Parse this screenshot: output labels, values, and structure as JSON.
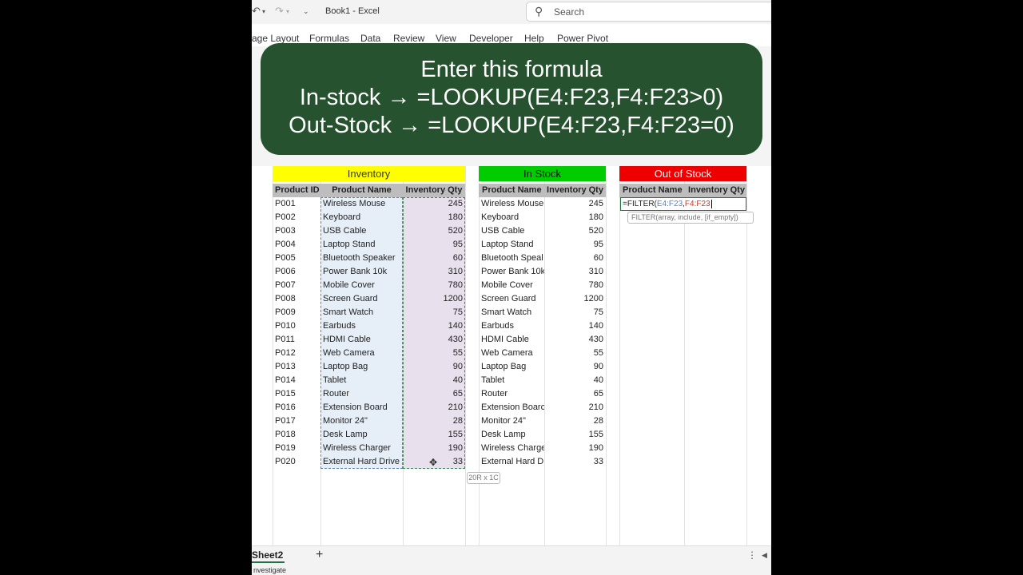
{
  "window": {
    "title": "Book1 - Excel"
  },
  "search": {
    "placeholder": "Search"
  },
  "ribbon_tabs": [
    "age Layout",
    "Formulas",
    "Data",
    "Review",
    "View",
    "Developer",
    "Help",
    "Power Pivot"
  ],
  "overlay": {
    "line1": "Enter this formula",
    "line2": "In-stock → =LOOKUP(E4:F23,F4:F23>0)",
    "line3": "Out-Stock → =LOOKUP(E4:F23,F4:F23=0)"
  },
  "inventory": {
    "title": "Inventory",
    "headers": [
      "Product ID",
      "Product Name",
      "Inventory Qty"
    ],
    "rows": [
      [
        "P001",
        "Wireless Mouse",
        "245"
      ],
      [
        "P002",
        "Keyboard",
        "180"
      ],
      [
        "P003",
        "USB Cable",
        "520"
      ],
      [
        "P004",
        "Laptop Stand",
        "95"
      ],
      [
        "P005",
        "Bluetooth Speaker",
        "60"
      ],
      [
        "P006",
        "Power Bank 10k",
        "310"
      ],
      [
        "P007",
        "Mobile Cover",
        "780"
      ],
      [
        "P008",
        "Screen Guard",
        "1200"
      ],
      [
        "P009",
        "Smart Watch",
        "75"
      ],
      [
        "P010",
        "Earbuds",
        "140"
      ],
      [
        "P011",
        "HDMI Cable",
        "430"
      ],
      [
        "P012",
        "Web Camera",
        "55"
      ],
      [
        "P013",
        "Laptop Bag",
        "90"
      ],
      [
        "P014",
        "Tablet",
        "40"
      ],
      [
        "P015",
        "Router",
        "65"
      ],
      [
        "P016",
        "Extension Board",
        "210"
      ],
      [
        "P017",
        "Monitor 24\"",
        "28"
      ],
      [
        "P018",
        "Desk Lamp",
        "155"
      ],
      [
        "P019",
        "Wireless Charger",
        "190"
      ],
      [
        "P020",
        "External Hard Drive",
        "33"
      ]
    ]
  },
  "in_stock": {
    "title": "In Stock",
    "headers": [
      "Product Name",
      "Inventory Qty"
    ],
    "rows": [
      [
        "Wireless Mouse",
        "245"
      ],
      [
        "Keyboard",
        "180"
      ],
      [
        "USB Cable",
        "520"
      ],
      [
        "Laptop Stand",
        "95"
      ],
      [
        "Bluetooth Speal",
        "60"
      ],
      [
        "Power Bank 10k",
        "310"
      ],
      [
        "Mobile Cover",
        "780"
      ],
      [
        "Screen Guard",
        "1200"
      ],
      [
        "Smart Watch",
        "75"
      ],
      [
        "Earbuds",
        "140"
      ],
      [
        "HDMI Cable",
        "430"
      ],
      [
        "Web Camera",
        "55"
      ],
      [
        "Laptop Bag",
        "90"
      ],
      [
        "Tablet",
        "40"
      ],
      [
        "Router",
        "65"
      ],
      [
        "Extension Boarc",
        "210"
      ],
      [
        "Monitor 24\"",
        "28"
      ],
      [
        "Desk Lamp",
        "155"
      ],
      [
        "Wireless Charge",
        "190"
      ],
      [
        "External Hard D",
        "33"
      ]
    ]
  },
  "out_of_stock": {
    "title": "Out of Stock",
    "headers": [
      "Product Name",
      "Inventory Qty"
    ],
    "formula_prefix": "=FILTER(",
    "formula_ref1": "E4:F23",
    "formula_sep": ",",
    "formula_ref2": "F4:F23",
    "tooltip": "FILTER(array, include, [if_empty])"
  },
  "dimension_tip": "20R x 1C",
  "sheet_tab": "Sheet2",
  "status_text": "nvestigate",
  "colors": {
    "inventory_header": "#ffff00",
    "in_stock_header": "#00cc00",
    "out_of_stock_header": "#ee0000",
    "overlay_bg": "#27522f",
    "selection_name": "#e6eef8",
    "selection_qty": "#e8e0ec"
  }
}
